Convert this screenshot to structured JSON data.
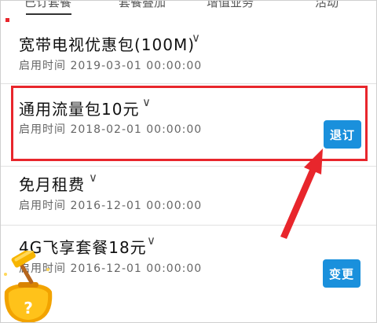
{
  "tabs": [
    "已订套餐",
    "套餐叠加",
    "增值业务",
    "活动"
  ],
  "items": [
    {
      "title": "宽带电视优惠包(100M)",
      "date": "启用时间 2019-03-01 00:00:00"
    },
    {
      "title": "通用流量包10元",
      "date": "启用时间 2018-02-01 00:00:00",
      "action": "退订"
    },
    {
      "title": "免月租费",
      "date": "启用时间 2016-12-01 00:00:00"
    },
    {
      "title": "4G飞享套餐18元",
      "date": "启用时间 2016-12-01 00:00:00",
      "action": "变更"
    }
  ],
  "colors": {
    "accent_blue": "#1a90dc",
    "highlight_red": "#e8262c"
  },
  "icons": [
    "chevron-down-icon",
    "gift-bag-icon",
    "hammer-icon"
  ]
}
